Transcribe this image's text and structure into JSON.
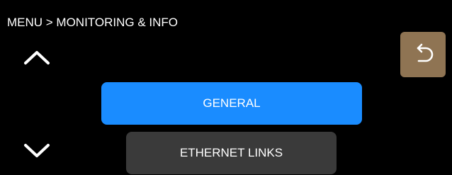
{
  "header": {
    "breadcrumb": "MENU > MONITORING & INFO"
  },
  "navigation": {
    "up_icon": "chevron-up-icon",
    "down_icon": "chevron-down-icon",
    "back_icon": "back-arrow-icon"
  },
  "menu": {
    "items": [
      {
        "label": "GENERAL",
        "selected": true
      },
      {
        "label": "ETHERNET LINKS",
        "selected": false
      }
    ]
  },
  "colors": {
    "background": "#000000",
    "selected": "#1a8cff",
    "unselected": "#3a3a3a",
    "back_button": "#8f7453",
    "text": "#ffffff"
  }
}
